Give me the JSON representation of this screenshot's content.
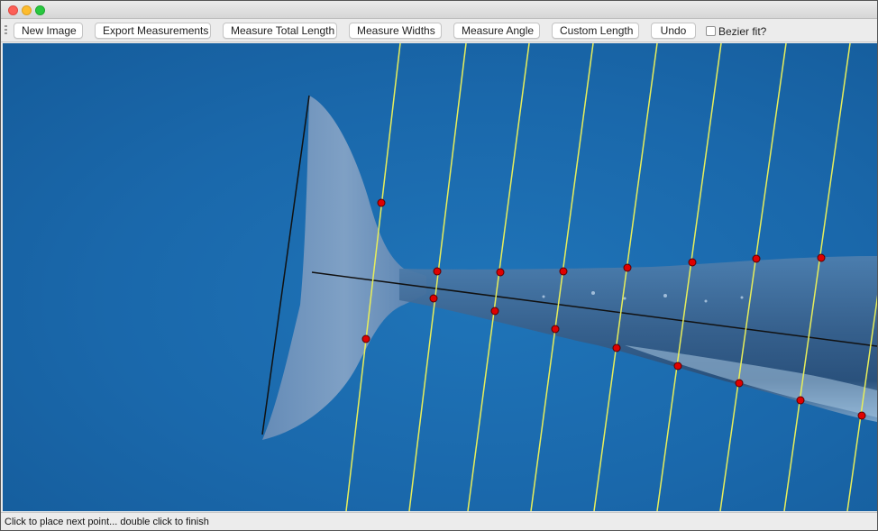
{
  "window": {
    "traffic_lights": {
      "close": "#fc5f57",
      "minimize": "#fdbc2e",
      "zoom": "#28c840"
    }
  },
  "toolbar": {
    "new_image": "New Image",
    "export_measurements": "Export Measurements",
    "measure_total_length": "Measure Total Length",
    "measure_widths": "Measure Widths",
    "measure_angle": "Measure Angle",
    "custom_length": "Custom Length",
    "undo": "Undo",
    "bezier_fit_label": "Bezier fit?",
    "bezier_fit_checked": false
  },
  "canvas": {
    "background_color": "#1a68ab",
    "width_line_color": "#e8ee5a",
    "length_line_color": "#111111",
    "point_color": "#e00000"
  },
  "status": {
    "message": "Click to place next point... double click to finish"
  }
}
